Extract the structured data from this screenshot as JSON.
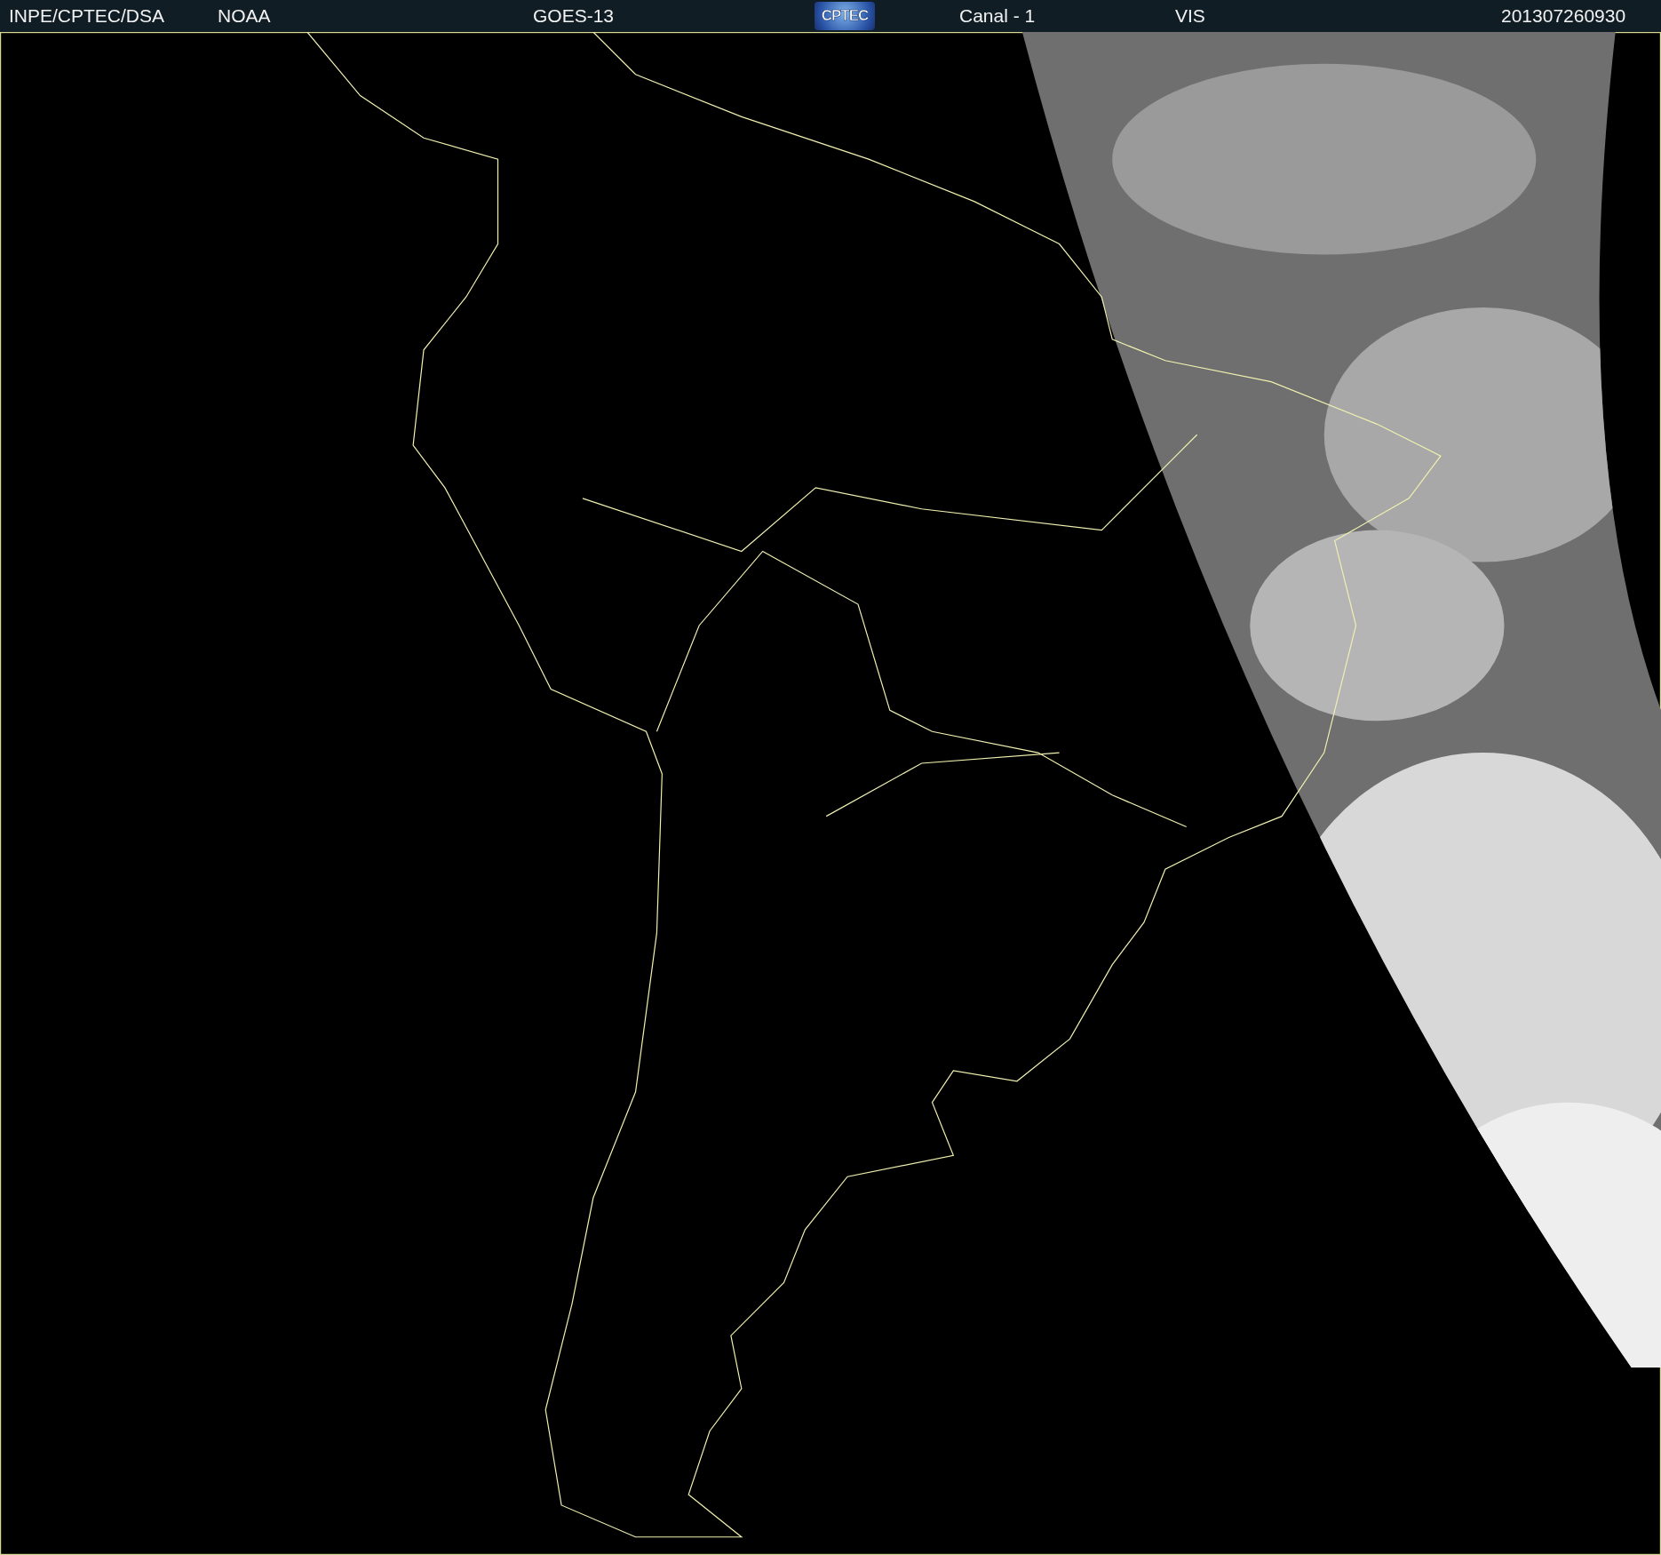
{
  "header": {
    "source": "INPE/CPTEC/DSA",
    "agency": "NOAA",
    "satellite": "GOES-13",
    "logo": "CPTEC",
    "channel": "Canal - 1",
    "band": "VIS",
    "timestamp": "201307260930"
  }
}
